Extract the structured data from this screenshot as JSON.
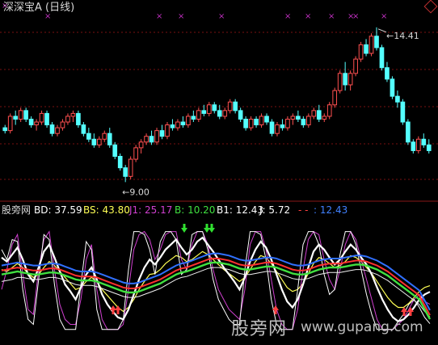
{
  "header": {
    "title": "深深宝A (日线)",
    "high_label": "14.41",
    "low_label": "9.00"
  },
  "indicator": {
    "name": "股旁网",
    "bd": "BD: 37.59",
    "bs": "BS: 43.80",
    "j1": "J1: 25.17",
    "b": "B: 10.20",
    "b1": "B1: 12.43",
    "j": "J: 5.72",
    "dash": "- -",
    "last": ": 12.43"
  },
  "watermark": {
    "cn": "股旁网",
    "url": "www.gupang.com"
  },
  "colors": {
    "up": "#ff5050",
    "down": "#54ffff",
    "grid": "#7a1010",
    "magenta": "#d040d0",
    "bd": "#ffffff",
    "bs": "#ffff55",
    "j1": "#d040d0",
    "b": "#40e040",
    "b1": "#ffffff",
    "j": "#ffffff",
    "dash": "#ff4040",
    "last": "#4080ff",
    "marker": "#c030c0"
  },
  "chart_data": [
    {
      "type": "candlestick",
      "title": "深深宝A (日线)",
      "annotations": [
        {
          "label": "14.41",
          "kind": "high"
        },
        {
          "label": "9.00",
          "kind": "low"
        }
      ],
      "ylim": [
        8.7,
        14.8
      ],
      "candles": [
        [
          10.9,
          11.0,
          10.7,
          10.8
        ],
        [
          10.8,
          11.4,
          10.7,
          11.3
        ],
        [
          11.3,
          11.5,
          11.0,
          11.2
        ],
        [
          11.2,
          11.6,
          11.1,
          11.5
        ],
        [
          11.5,
          11.6,
          11.1,
          11.2
        ],
        [
          11.2,
          11.3,
          10.9,
          11.0
        ],
        [
          11.0,
          11.2,
          10.8,
          11.1
        ],
        [
          11.1,
          11.5,
          11.0,
          11.4
        ],
        [
          11.4,
          11.5,
          10.9,
          11.0
        ],
        [
          11.0,
          11.1,
          10.6,
          10.7
        ],
        [
          10.7,
          11.0,
          10.6,
          10.9
        ],
        [
          10.9,
          11.2,
          10.8,
          11.1
        ],
        [
          11.1,
          11.4,
          11.0,
          11.3
        ],
        [
          11.3,
          11.5,
          11.1,
          11.4
        ],
        [
          11.4,
          11.5,
          10.9,
          11.0
        ],
        [
          11.0,
          11.1,
          10.6,
          10.7
        ],
        [
          10.7,
          10.9,
          10.4,
          10.5
        ],
        [
          10.5,
          10.7,
          10.2,
          10.3
        ],
        [
          10.3,
          10.6,
          10.2,
          10.5
        ],
        [
          10.5,
          10.8,
          10.4,
          10.7
        ],
        [
          10.7,
          10.9,
          10.2,
          10.3
        ],
        [
          10.3,
          10.4,
          9.8,
          9.9
        ],
        [
          9.9,
          10.0,
          9.4,
          9.5
        ],
        [
          9.5,
          9.6,
          9.0,
          9.2
        ],
        [
          9.2,
          9.9,
          9.1,
          9.8
        ],
        [
          9.8,
          10.3,
          9.7,
          10.2
        ],
        [
          10.2,
          10.5,
          10.0,
          10.4
        ],
        [
          10.4,
          10.7,
          10.3,
          10.6
        ],
        [
          10.6,
          10.8,
          10.3,
          10.4
        ],
        [
          10.4,
          10.9,
          10.3,
          10.8
        ],
        [
          10.8,
          11.0,
          10.5,
          10.6
        ],
        [
          10.6,
          11.1,
          10.5,
          11.0
        ],
        [
          11.0,
          11.2,
          10.8,
          10.9
        ],
        [
          10.9,
          11.2,
          10.8,
          11.1
        ],
        [
          11.1,
          11.3,
          10.9,
          11.0
        ],
        [
          11.0,
          11.4,
          10.9,
          11.3
        ],
        [
          11.3,
          11.5,
          11.1,
          11.2
        ],
        [
          11.2,
          11.6,
          11.1,
          11.5
        ],
        [
          11.5,
          11.7,
          11.3,
          11.4
        ],
        [
          11.4,
          11.8,
          11.3,
          11.7
        ],
        [
          11.7,
          11.8,
          11.4,
          11.5
        ],
        [
          11.5,
          11.7,
          11.2,
          11.3
        ],
        [
          11.3,
          11.6,
          11.2,
          11.5
        ],
        [
          11.5,
          11.9,
          11.4,
          11.8
        ],
        [
          11.8,
          11.9,
          11.4,
          11.5
        ],
        [
          11.5,
          11.6,
          11.1,
          11.2
        ],
        [
          11.2,
          11.3,
          10.8,
          10.9
        ],
        [
          10.9,
          11.3,
          10.8,
          11.2
        ],
        [
          11.2,
          11.3,
          10.9,
          11.0
        ],
        [
          11.0,
          11.4,
          10.9,
          11.3
        ],
        [
          11.3,
          11.4,
          11.0,
          11.1
        ],
        [
          11.1,
          11.2,
          10.6,
          10.7
        ],
        [
          10.7,
          11.1,
          10.6,
          11.0
        ],
        [
          11.0,
          11.2,
          10.8,
          10.9
        ],
        [
          10.9,
          11.3,
          10.8,
          11.2
        ],
        [
          11.2,
          11.4,
          11.0,
          11.3
        ],
        [
          11.3,
          11.5,
          11.1,
          11.2
        ],
        [
          11.2,
          11.3,
          10.9,
          11.0
        ],
        [
          11.0,
          11.4,
          10.9,
          11.3
        ],
        [
          11.3,
          11.6,
          11.2,
          11.5
        ],
        [
          11.5,
          11.7,
          11.1,
          11.2
        ],
        [
          11.2,
          11.4,
          11.1,
          11.3
        ],
        [
          11.3,
          11.8,
          11.2,
          11.7
        ],
        [
          11.7,
          12.3,
          11.6,
          12.2
        ],
        [
          12.2,
          12.9,
          12.1,
          12.8
        ],
        [
          12.8,
          13.2,
          12.2,
          12.4
        ],
        [
          12.4,
          12.9,
          12.2,
          12.8
        ],
        [
          12.8,
          13.4,
          12.7,
          13.3
        ],
        [
          13.3,
          13.9,
          13.2,
          13.8
        ],
        [
          13.8,
          14.0,
          13.4,
          13.5
        ],
        [
          13.5,
          14.2,
          13.4,
          14.1
        ],
        [
          14.1,
          14.41,
          13.6,
          13.7
        ],
        [
          13.7,
          13.8,
          12.9,
          13.0
        ],
        [
          13.0,
          13.2,
          12.5,
          12.6
        ],
        [
          12.6,
          12.7,
          11.9,
          12.0
        ],
        [
          12.0,
          12.2,
          11.6,
          11.8
        ],
        [
          11.8,
          11.9,
          11.0,
          11.1
        ],
        [
          11.1,
          11.2,
          10.3,
          10.4
        ],
        [
          10.4,
          10.5,
          10.0,
          10.1
        ],
        [
          10.1,
          10.6,
          10.0,
          10.5
        ],
        [
          10.5,
          10.7,
          10.2,
          10.3
        ],
        [
          10.3,
          10.5,
          10.0,
          10.1
        ]
      ]
    },
    {
      "type": "line",
      "title": "股旁网",
      "ylim": [
        -10,
        105
      ],
      "series": [
        {
          "name": "BD",
          "values": [
            72,
            68,
            75,
            82,
            70,
            55,
            48,
            62,
            78,
            85,
            72,
            58,
            45,
            38,
            30,
            42,
            55,
            62,
            50,
            35,
            25,
            18,
            12,
            10,
            20,
            35,
            50,
            62,
            70,
            65,
            72,
            80,
            85,
            90,
            82,
            75,
            80,
            88,
            92,
            85,
            78,
            70,
            62,
            55,
            48,
            40,
            52,
            68,
            80,
            88,
            82,
            70,
            55,
            40,
            28,
            22,
            30,
            45,
            62,
            78,
            85,
            80,
            72,
            65,
            70,
            78,
            85,
            80,
            72,
            65,
            55,
            42,
            30,
            20,
            12,
            8,
            10,
            15,
            22,
            30,
            35,
            37.59
          ]
        },
        {
          "name": "BS",
          "values": [
            60,
            58,
            62,
            66,
            62,
            56,
            52,
            55,
            62,
            68,
            64,
            58,
            52,
            46,
            40,
            42,
            48,
            52,
            48,
            40,
            34,
            28,
            22,
            18,
            22,
            30,
            40,
            48,
            55,
            56,
            60,
            66,
            70,
            74,
            72,
            68,
            70,
            74,
            78,
            75,
            70,
            65,
            60,
            56,
            52,
            48,
            52,
            60,
            68,
            74,
            72,
            66,
            58,
            50,
            42,
            38,
            40,
            46,
            56,
            66,
            72,
            70,
            66,
            62,
            64,
            68,
            74,
            72,
            68,
            62,
            56,
            48,
            40,
            32,
            26,
            22,
            22,
            26,
            32,
            38,
            42,
            43.8
          ]
        },
        {
          "name": "J1",
          "values": [
            40,
            60,
            85,
            95,
            55,
            20,
            15,
            60,
            90,
            98,
            60,
            25,
            10,
            5,
            5,
            30,
            70,
            85,
            40,
            10,
            0,
            0,
            0,
            5,
            40,
            80,
            95,
            98,
            90,
            70,
            80,
            95,
            98,
            98,
            70,
            60,
            85,
            98,
            98,
            85,
            60,
            40,
            30,
            20,
            15,
            10,
            40,
            85,
            98,
            98,
            80,
            50,
            20,
            5,
            0,
            0,
            20,
            60,
            90,
            98,
            95,
            70,
            50,
            40,
            60,
            85,
            98,
            90,
            70,
            50,
            30,
            10,
            0,
            0,
            0,
            5,
            10,
            20,
            30,
            35,
            28,
            25.17
          ]
        },
        {
          "name": "B",
          "values": [
            55,
            56,
            57,
            58,
            57,
            56,
            55,
            55,
            56,
            57,
            57,
            56,
            54,
            52,
            50,
            49,
            49,
            49,
            48,
            46,
            44,
            42,
            40,
            38,
            37,
            37,
            38,
            40,
            42,
            44,
            46,
            49,
            52,
            55,
            57,
            58,
            60,
            62,
            64,
            66,
            67,
            67,
            66,
            65,
            63,
            61,
            60,
            60,
            61,
            62,
            63,
            63,
            62,
            60,
            58,
            56,
            55,
            55,
            56,
            58,
            60,
            61,
            62,
            62,
            62,
            63,
            64,
            65,
            65,
            64,
            62,
            60,
            57,
            54,
            50,
            46,
            42,
            38,
            34,
            30,
            20,
            10.2
          ]
        },
        {
          "name": "B1",
          "values": [
            48,
            49,
            50,
            52,
            52,
            51,
            50,
            50,
            51,
            52,
            52,
            51,
            49,
            47,
            45,
            44,
            44,
            44,
            43,
            41,
            39,
            37,
            35,
            33,
            32,
            32,
            33,
            35,
            37,
            39,
            41,
            44,
            47,
            50,
            52,
            53,
            55,
            57,
            59,
            61,
            62,
            62,
            61,
            60,
            58,
            56,
            55,
            55,
            56,
            57,
            58,
            58,
            57,
            55,
            53,
            51,
            50,
            50,
            51,
            53,
            55,
            56,
            57,
            57,
            57,
            58,
            59,
            60,
            60,
            59,
            57,
            55,
            52,
            49,
            45,
            41,
            37,
            33,
            29,
            25,
            18,
            12.43
          ]
        },
        {
          "name": "J",
          "values": [
            80,
            70,
            90,
            88,
            40,
            10,
            5,
            50,
            95,
            90,
            45,
            10,
            0,
            0,
            0,
            45,
            88,
            80,
            20,
            0,
            0,
            0,
            0,
            10,
            60,
            98,
            98,
            95,
            80,
            55,
            88,
            98,
            98,
            90,
            55,
            60,
            95,
            98,
            98,
            80,
            50,
            30,
            20,
            10,
            5,
            5,
            60,
            98,
            98,
            95,
            70,
            30,
            5,
            0,
            0,
            0,
            40,
            85,
            98,
            98,
            85,
            55,
            35,
            40,
            75,
            98,
            98,
            85,
            60,
            35,
            15,
            0,
            0,
            0,
            0,
            8,
            15,
            25,
            30,
            22,
            12,
            5.72
          ]
        }
      ]
    }
  ]
}
